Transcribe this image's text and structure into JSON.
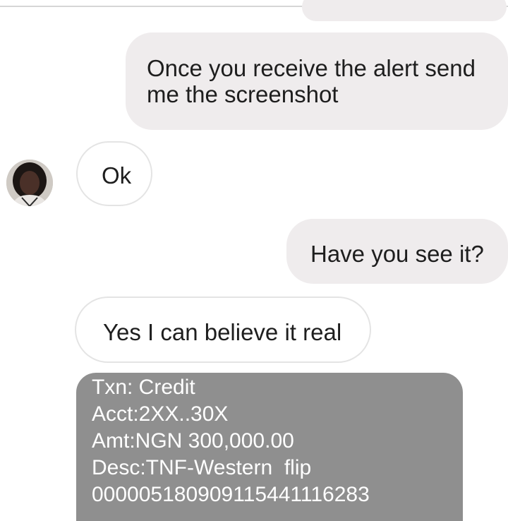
{
  "conversation": {
    "messages": [
      {
        "from": "me",
        "text": "Once you receive the alert send me the screenshot"
      },
      {
        "from": "contact",
        "text": "Ok"
      },
      {
        "from": "me",
        "text": "Have you see it?"
      },
      {
        "from": "contact",
        "text": "Yes I can believe it real"
      }
    ],
    "alert": {
      "lines": [
        "Txn: Credit",
        "Acct:2XX..30X",
        "Amt:NGN 300,000.00",
        "Desc:TNF-Western  flip",
        "00000518090911544111​6283"
      ]
    }
  },
  "colors": {
    "sent_bubble": "#efeced",
    "received_bubble": "#ffffff",
    "alert_bubble": "#8f8f8f"
  }
}
